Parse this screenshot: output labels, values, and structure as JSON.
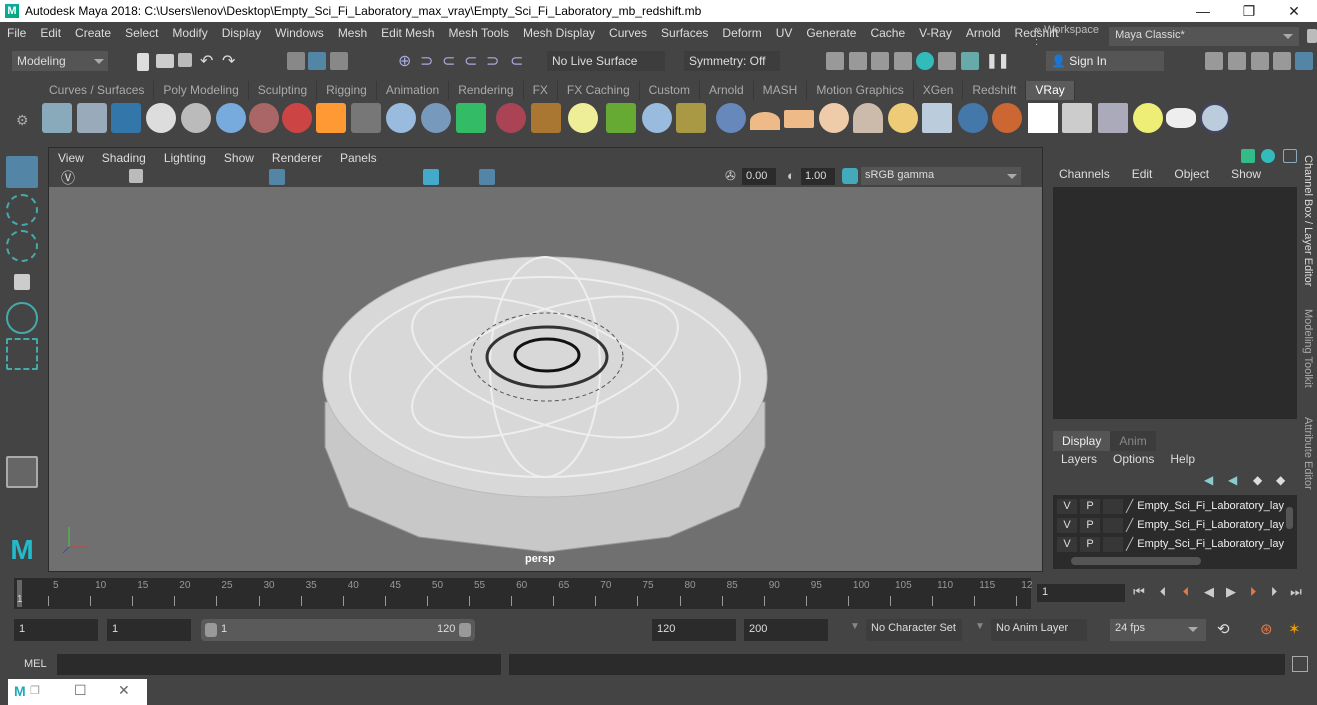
{
  "window": {
    "title": "Autodesk Maya 2018: C:\\Users\\lenov\\Desktop\\Empty_Sci_Fi_Laboratory_max_vray\\Empty_Sci_Fi_Laboratory_mb_redshift.mb",
    "logo": "M",
    "controls": {
      "minimize": "—",
      "restore": "❐",
      "close": "✕"
    }
  },
  "menubar": {
    "items": [
      "File",
      "Edit",
      "Create",
      "Select",
      "Modify",
      "Display",
      "Windows",
      "Mesh",
      "Edit Mesh",
      "Mesh Tools",
      "Mesh Display",
      "Curves",
      "Surfaces",
      "Deform",
      "UV",
      "Generate",
      "Cache",
      "V-Ray",
      "Arnold",
      "Redshift"
    ],
    "workspace_label": "» Workspace :",
    "workspace_value": "Maya Classic*"
  },
  "statusline": {
    "mode": "Modeling",
    "live_surface": "No Live Surface",
    "symmetry": "Symmetry: Off",
    "sign_in": "Sign In"
  },
  "shelf": {
    "tabs": [
      "Curves / Surfaces",
      "Poly Modeling",
      "Sculpting",
      "Rigging",
      "Animation",
      "Rendering",
      "FX",
      "FX Caching",
      "Custom",
      "Arnold",
      "MASH",
      "Motion Graphics",
      "XGen",
      "Redshift",
      "VRay"
    ],
    "active_tab": "VRay"
  },
  "viewport": {
    "menu": [
      "View",
      "Shading",
      "Lighting",
      "Show",
      "Renderer",
      "Panels"
    ],
    "exposure": "0.00",
    "gamma": "1.00",
    "color_space": "sRGB gamma",
    "camera_label": "persp"
  },
  "channel_box": {
    "menu": [
      "Channels",
      "Edit",
      "Object",
      "Show"
    ]
  },
  "layer_editor": {
    "tabs": [
      "Display",
      "Anim"
    ],
    "active_tab": "Display",
    "menu": [
      "Layers",
      "Options",
      "Help"
    ],
    "layers": [
      {
        "v": "V",
        "p": "P",
        "name": "Empty_Sci_Fi_Laboratory_lay"
      },
      {
        "v": "V",
        "p": "P",
        "name": "Empty_Sci_Fi_Laboratory_lay"
      },
      {
        "v": "V",
        "p": "P",
        "name": "Empty_Sci_Fi_Laboratory_lay"
      }
    ]
  },
  "side_tabs": [
    "Channel Box / Layer Editor",
    "Modeling Toolkit",
    "Attribute Editor"
  ],
  "timeline": {
    "ticks": [
      "5",
      "10",
      "15",
      "20",
      "25",
      "30",
      "35",
      "40",
      "45",
      "50",
      "55",
      "60",
      "65",
      "70",
      "75",
      "80",
      "85",
      "90",
      "95",
      "100",
      "105",
      "110",
      "115",
      "12"
    ],
    "current_frame_marker": "1",
    "current_frame": "1"
  },
  "range": {
    "start": "1",
    "playback_start": "1",
    "slider_start": "1",
    "slider_end": "120",
    "playback_end": "120",
    "end": "200",
    "character_set": "No Character Set",
    "anim_layer": "No Anim Layer",
    "fps": "24 fps"
  },
  "command_line": {
    "label": "MEL"
  },
  "colors": {
    "accent": "#5285a6",
    "playhead": "#e07a4a",
    "bg": "#444444"
  }
}
